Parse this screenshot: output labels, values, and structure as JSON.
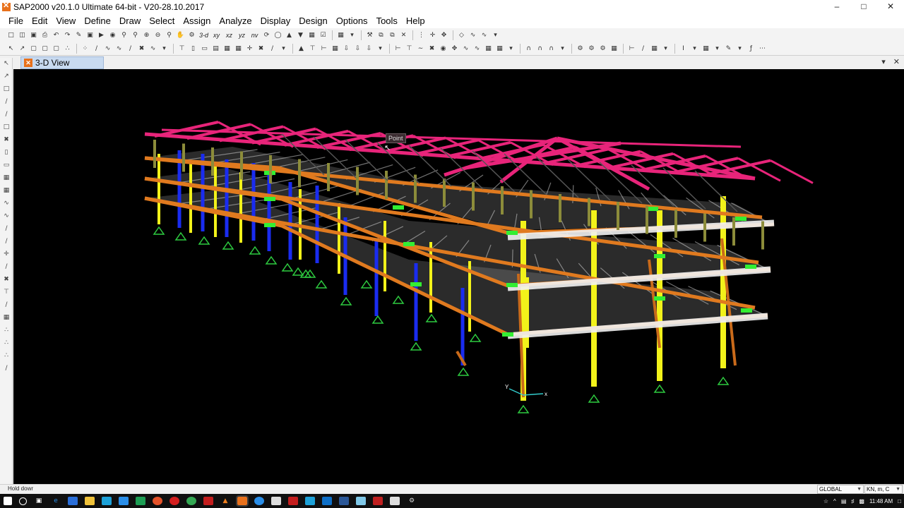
{
  "window": {
    "title": "SAP2000 v20.1.0 Ultimate 64-bit - V20-28.10.2017",
    "minimize": "–",
    "maximize": "□",
    "close": "✕"
  },
  "menu": [
    "File",
    "Edit",
    "View",
    "Define",
    "Draw",
    "Select",
    "Assign",
    "Analyze",
    "Display",
    "Design",
    "Options",
    "Tools",
    "Help"
  ],
  "toolbar1": {
    "view_labels": [
      "3-d",
      "xy",
      "xz",
      "yz",
      "nv"
    ]
  },
  "tab": {
    "label": "3-D View",
    "dropdown": "▾",
    "close": "✕"
  },
  "viewport": {
    "tooltip": "Point",
    "axis_x": "x",
    "axis_y": "Y"
  },
  "status": {
    "text": "Hold dowr",
    "coord_system": "GLOBAL",
    "units": "KN, m, C"
  },
  "taskbar": {
    "time": "11:48 AM"
  },
  "colors": {
    "viewport_bg": "#000000",
    "roof_truss": "#e8247a",
    "beam": "#e07a1f",
    "column_yellow": "#f2f21a",
    "column_blue": "#1a2cf0",
    "slab": "#d9d9d9",
    "support": "#2ecc40",
    "node": "#33ee33"
  }
}
